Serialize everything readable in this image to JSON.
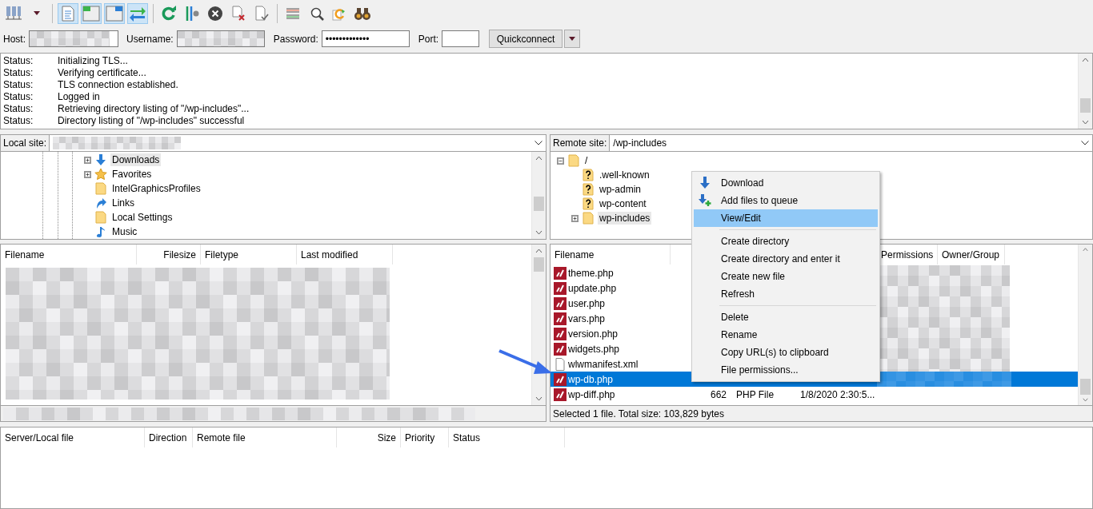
{
  "toolbar": [
    {
      "kind": "servers"
    },
    {
      "kind": "caret"
    },
    {
      "kind": "log",
      "selected": true
    },
    {
      "kind": "local-tree",
      "selected": true
    },
    {
      "kind": "remote-tree",
      "selected": true
    },
    {
      "kind": "transfer",
      "selected": true
    },
    {
      "kind": "refresh"
    },
    {
      "kind": "sliders"
    },
    {
      "kind": "cancel"
    },
    {
      "kind": "file-x"
    },
    {
      "kind": "file-check"
    },
    {
      "kind": "list"
    },
    {
      "kind": "search"
    },
    {
      "kind": "sync"
    },
    {
      "kind": "binoculars"
    }
  ],
  "quickconnect": {
    "host_label": "Host:",
    "username_label": "Username:",
    "password_label": "Password:",
    "password": "•••••••••••••",
    "port_label": "Port:",
    "button": "Quickconnect"
  },
  "message_log": [
    {
      "label": "Status:",
      "text": "Initializing TLS..."
    },
    {
      "label": "Status:",
      "text": "Verifying certificate..."
    },
    {
      "label": "Status:",
      "text": "TLS connection established."
    },
    {
      "label": "Status:",
      "text": "Logged in"
    },
    {
      "label": "Status:",
      "text": "Retrieving directory listing of \"/wp-includes\"..."
    },
    {
      "label": "Status:",
      "text": "Directory listing of \"/wp-includes\" successful"
    }
  ],
  "local": {
    "site_label": "Local site:",
    "tree": [
      {
        "name": "Downloads",
        "kind": "download",
        "expanded": false,
        "selected": true
      },
      {
        "name": "Favorites",
        "kind": "star",
        "expanded": false,
        "selected": false
      },
      {
        "name": "IntelGraphicsProfiles",
        "kind": "folder",
        "selected": false
      },
      {
        "name": "Links",
        "kind": "link",
        "selected": false
      },
      {
        "name": "Local Settings",
        "kind": "folder",
        "selected": false
      },
      {
        "name": "Music",
        "kind": "music",
        "selected": false
      }
    ],
    "columns": [
      "Filename",
      "Filesize",
      "Filetype",
      "Last modified"
    ]
  },
  "remote": {
    "site_label": "Remote site:",
    "path": "/wp-includes",
    "tree": [
      {
        "name": "/",
        "kind": "folder",
        "expanded": true,
        "selected": false,
        "children": [
          {
            "name": ".well-known",
            "kind": "unknown",
            "selected": false
          },
          {
            "name": "wp-admin",
            "kind": "unknown",
            "selected": false
          },
          {
            "name": "wp-content",
            "kind": "unknown",
            "selected": false
          },
          {
            "name": "wp-includes",
            "kind": "folder",
            "expanded": false,
            "selected": true
          }
        ]
      }
    ],
    "columns": [
      "Filename",
      "Permissions",
      "Owner/Group"
    ],
    "files": [
      {
        "name": "theme.php",
        "kind": "php",
        "selected": false
      },
      {
        "name": "update.php",
        "kind": "php",
        "selected": false
      },
      {
        "name": "user.php",
        "kind": "php",
        "selected": false
      },
      {
        "name": "vars.php",
        "kind": "php",
        "selected": false
      },
      {
        "name": "version.php",
        "kind": "php",
        "selected": false
      },
      {
        "name": "widgets.php",
        "kind": "php",
        "selected": false
      },
      {
        "name": "wlwmanifest.xml",
        "kind": "text",
        "selected": false
      },
      {
        "name": "wp-db.php",
        "kind": "php",
        "selected": true
      },
      {
        "name": "wp-diff.php",
        "kind": "php",
        "selected": false,
        "size": "662",
        "type": "PHP File",
        "modified": "1/8/2020 2:30:5..."
      }
    ],
    "status": "Selected 1 file. Total size: 103,829 bytes"
  },
  "context_menu": [
    {
      "kind": "download",
      "label": "Download",
      "selected": false
    },
    {
      "kind": "queue",
      "label": "Add files to queue",
      "selected": false
    },
    {
      "kind": "plain",
      "label": "View/Edit",
      "selected": true
    },
    {
      "kind": "separator"
    },
    {
      "kind": "plain",
      "label": "Create directory",
      "selected": false
    },
    {
      "kind": "plain",
      "label": "Create directory and enter it",
      "selected": false
    },
    {
      "kind": "plain",
      "label": "Create new file",
      "selected": false
    },
    {
      "kind": "plain",
      "label": "Refresh",
      "selected": false
    },
    {
      "kind": "separator"
    },
    {
      "kind": "plain",
      "label": "Delete",
      "selected": false
    },
    {
      "kind": "plain",
      "label": "Rename",
      "selected": false
    },
    {
      "kind": "plain",
      "label": "Copy URL(s) to clipboard",
      "selected": false
    },
    {
      "kind": "plain",
      "label": "File permissions...",
      "selected": false
    }
  ],
  "queue": {
    "columns": [
      "Server/Local file",
      "Direction",
      "Remote file",
      "Size",
      "Priority",
      "Status"
    ]
  }
}
